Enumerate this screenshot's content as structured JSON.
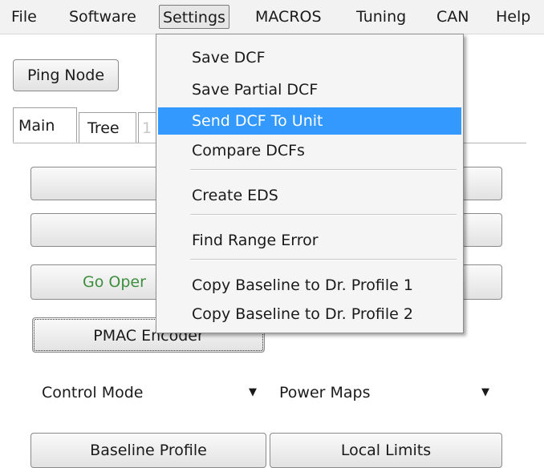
{
  "menubar": {
    "items": [
      "File",
      "Software",
      "Settings",
      "MACROS",
      "Tuning",
      "CAN",
      "Help"
    ]
  },
  "toolbar": {
    "ping_node": "Ping Node"
  },
  "tabs": [
    "Main",
    "Tree",
    "1"
  ],
  "main": {
    "go_oper_partial": "Go Oper",
    "pmac_encoder": "PMAC Encoder",
    "control_mode": "Control Mode",
    "power_maps": "Power Maps",
    "baseline_profile": "Baseline Profile",
    "local_limits": "Local Limits"
  },
  "settings_menu": {
    "items": [
      "Save DCF",
      "Save Partial DCF",
      "Send DCF To Unit",
      "Compare DCFs",
      "Create EDS",
      "Find Range Error",
      "Copy Baseline to Dr. Profile 1",
      "Copy Baseline to Dr. Profile 2"
    ],
    "highlighted": "Send DCF To Unit"
  },
  "colors": {
    "highlight": "#3399ff",
    "go_oper_text": "#3d8f3d",
    "menubar_bg": "#f2f2f2"
  }
}
